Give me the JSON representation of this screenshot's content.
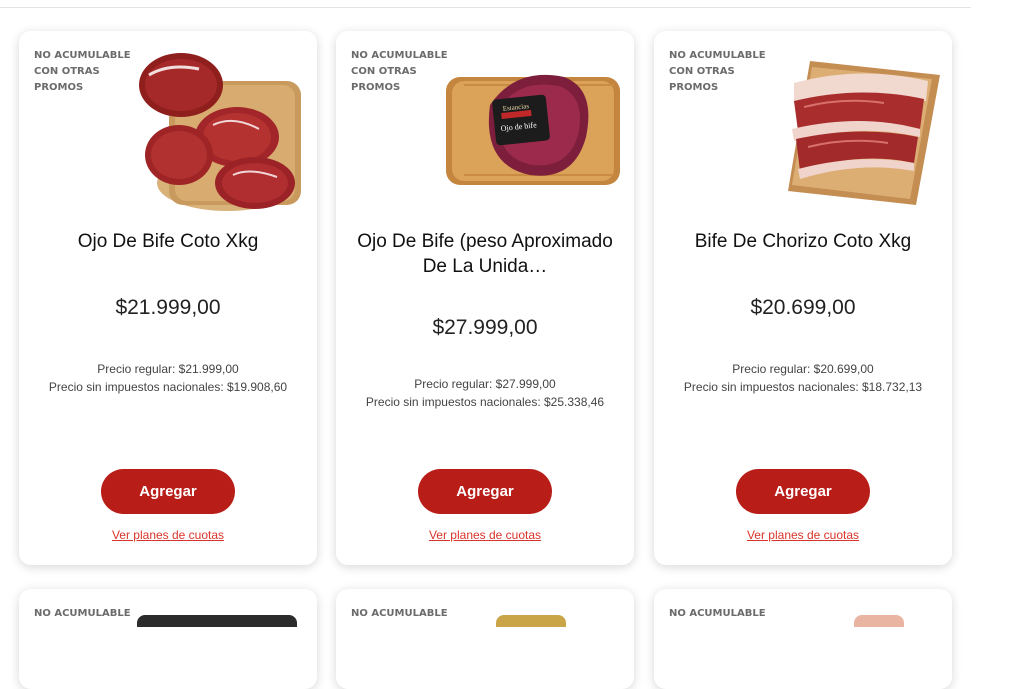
{
  "colors": {
    "accent": "#b81d17",
    "link": "#d9342b"
  },
  "products": [
    {
      "promo": "NO ACUMULABLE CON OTRAS PROMOS",
      "image_icon": "meat-steaks-on-board-icon",
      "title": "Ojo De Bife Coto Xkg",
      "price": "$21.999,00",
      "regular": "Precio regular: $21.999,00",
      "no_tax": "Precio sin impuestos nacionales: $19.908,60",
      "add_label": "Agregar",
      "cuotas_label": "Ver planes de cuotas"
    },
    {
      "promo": "NO ACUMULABLE CON OTRAS PROMOS",
      "image_icon": "vacuum-packed-meat-icon",
      "package_brand": "Estancias",
      "package_label": "Ojo de bife",
      "title": "Ojo De Bife (peso Aproximado De La Unida…",
      "price": "$27.999,00",
      "regular": "Precio regular: $27.999,00",
      "no_tax": "Precio sin impuestos nacionales: $25.338,46",
      "add_label": "Agregar",
      "cuotas_label": "Ver planes de cuotas"
    },
    {
      "promo": "NO ACUMULABLE CON OTRAS PROMOS",
      "image_icon": "sirloin-steaks-on-board-icon",
      "title": "Bife De Chorizo Coto Xkg",
      "price": "$20.699,00",
      "regular": "Precio regular: $20.699,00",
      "no_tax": "Precio sin impuestos nacionales: $18.732,13",
      "add_label": "Agregar",
      "cuotas_label": "Ver planes de cuotas"
    }
  ],
  "products_row2": [
    {
      "promo": "NO ACUMULABLE"
    },
    {
      "promo": "NO ACUMULABLE"
    },
    {
      "promo": "NO ACUMULABLE"
    }
  ]
}
